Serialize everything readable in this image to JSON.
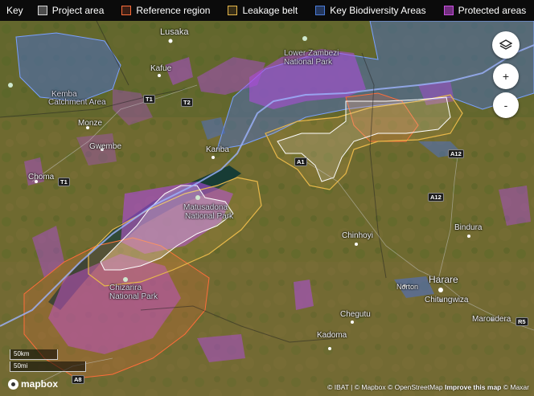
{
  "legend": {
    "title": "Key",
    "items": [
      {
        "label": "Project area",
        "color": "#d9d9d9"
      },
      {
        "label": "Reference region",
        "color": "#ff6d3a"
      },
      {
        "label": "Leakage belt",
        "color": "#e8b84a"
      },
      {
        "label": "Key Biodiversity Areas",
        "color": "#4a7bd8"
      },
      {
        "label": "Protected areas",
        "color": "#c94fe0"
      }
    ]
  },
  "places": {
    "lusaka": "Lusaka",
    "lower_zambezi_1": "Lower Zambezi",
    "lower_zambezi_2": "National Park",
    "kafue": "Kafue",
    "kemba_1": "Kemba",
    "kemba_2": "Catchment Area",
    "monze": "Monze",
    "gwembe": "Gwembe",
    "kariba": "Kariba",
    "choma": "Choma",
    "matusadona_1": "Matusadona",
    "matusadona_2": "National Park",
    "chinhoyi": "Chinhoyi",
    "bindura": "Bindura",
    "harare": "Harare",
    "norton": "Norton",
    "chitungwiza": "Chitungwiza",
    "chizarira_1": "Chizarira",
    "chizarira_2": "National Park",
    "chegutu": "Chegutu",
    "marondera": "Marondera",
    "kadoma": "Kadoma"
  },
  "roads": {
    "t1a": "T1",
    "t2": "T2",
    "t1b": "T1",
    "a1": "A1",
    "a12a": "A12",
    "a12b": "A12",
    "r5": "R5",
    "a8": "A8"
  },
  "controls": {
    "layers_icon": "layers-icon",
    "zoom_in": "+",
    "zoom_out": "-"
  },
  "scale": {
    "km": "50km",
    "mi": "50mi"
  },
  "attribution": {
    "text": "© IBAT | © Mapbox © OpenStreetMap",
    "improve": "Improve this map",
    "maxar": "© Maxar"
  },
  "logo": "mapbox"
}
